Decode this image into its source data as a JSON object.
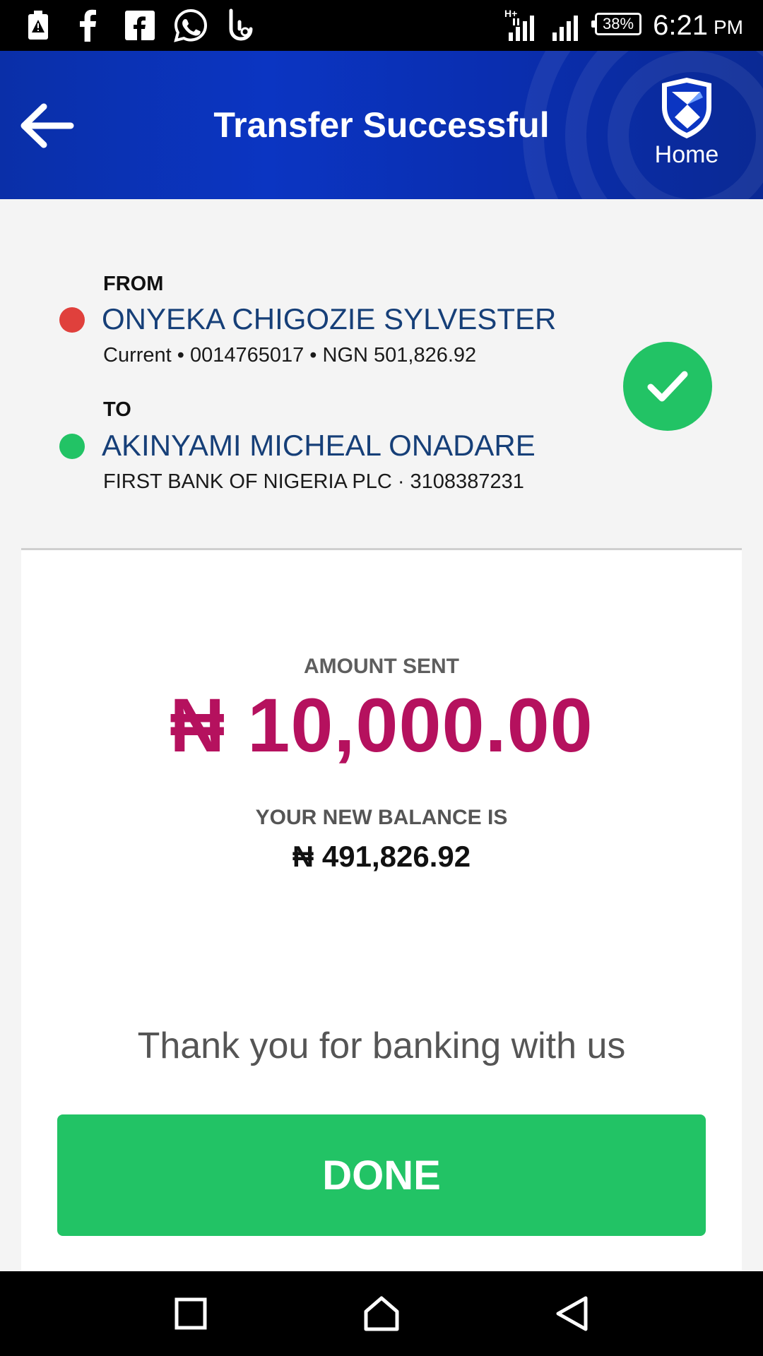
{
  "status_bar": {
    "icons": [
      "battery-alert-icon",
      "facebook-icon",
      "facebook-lite-icon",
      "whatsapp-icon",
      "touch-icon"
    ],
    "network": "H+",
    "battery": "38%",
    "time": "6:21",
    "ampm": "PM"
  },
  "header": {
    "title": "Transfer Successful",
    "home_label": "Home",
    "back_icon": "arrow-left-icon",
    "logo_icon": "bank-shield-logo",
    "background_color": "#0b35c2"
  },
  "transfer": {
    "from": {
      "label": "FROM",
      "name": "ONYEKA CHIGOZIE SYLVESTER",
      "details": "Current • 0014765017 • NGN 501,826.92",
      "dot_color": "#e0403c"
    },
    "to": {
      "label": "TO",
      "name": "AKINYAMI MICHEAL ONADARE",
      "details": "FIRST BANK OF NIGERIA PLC · 3108387231",
      "dot_color": "#22c365"
    },
    "status_icon": "check-icon"
  },
  "summary": {
    "amount_label": "AMOUNT SENT",
    "amount": "₦ 10,000.00",
    "amount_color": "#b5115e",
    "balance_label": "YOUR NEW BALANCE IS",
    "balance": "₦ 491,826.92",
    "thanks": "Thank you for banking with us"
  },
  "actions": {
    "done_label": "DONE",
    "done_color": "#22c365"
  },
  "nav_bar": {
    "icons": [
      "recent-apps-icon",
      "home-icon",
      "back-icon"
    ]
  }
}
